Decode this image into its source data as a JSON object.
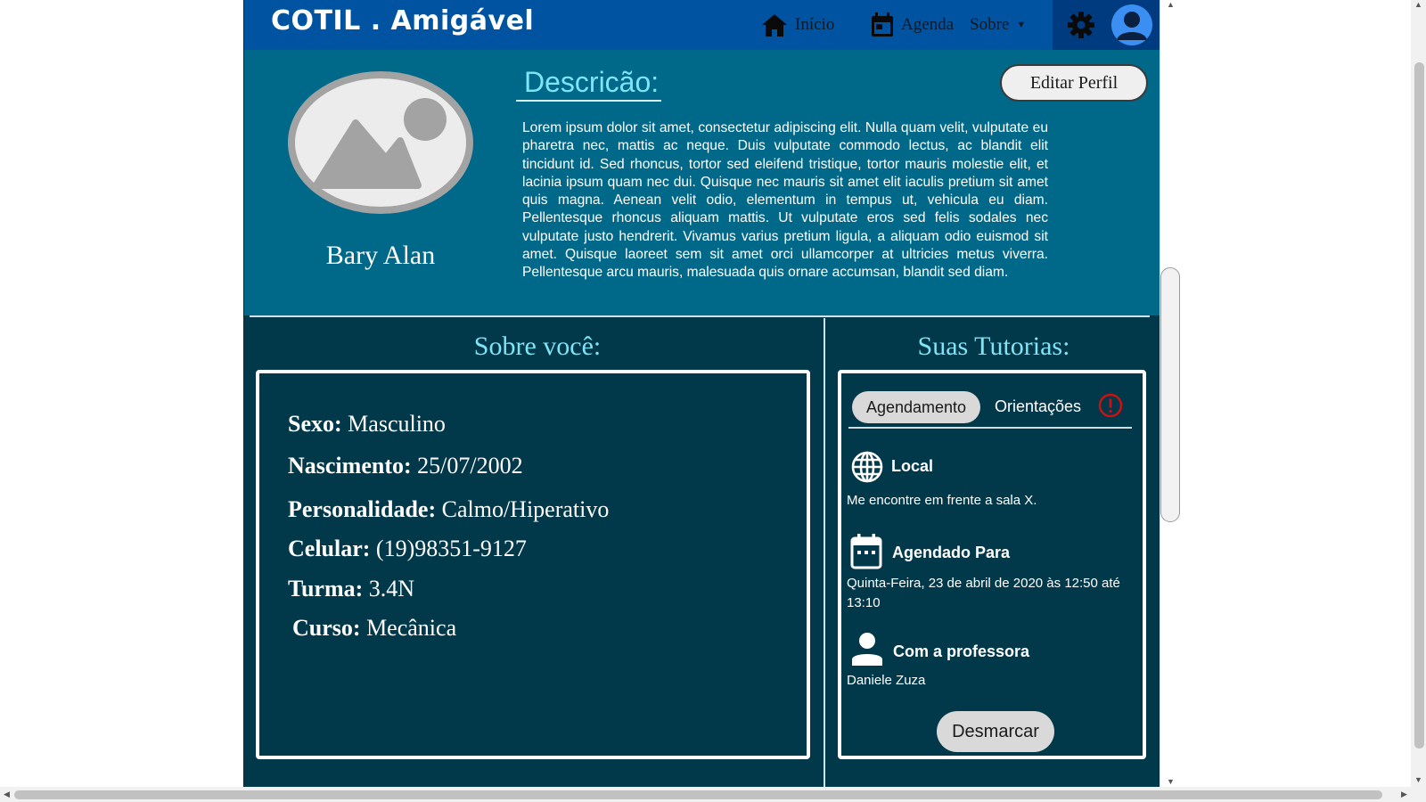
{
  "header": {
    "brand": "COTIL . Amigável",
    "nav": {
      "inicio": "Início",
      "agenda": "Agenda",
      "sobre": "Sobre"
    }
  },
  "profile": {
    "name": "Bary Alan",
    "description_title": "Descricão:",
    "description": "Lorem ipsum dolor sit amet, consectetur adipiscing elit. Nulla quam velit, vulputate eu pharetra nec, mattis ac neque. Duis vulputate commodo lectus, ac blandit elit tincidunt id. Sed rhoncus, tortor sed eleifend tristique, tortor mauris molestie elit, et lacinia ipsum quam nec dui. Quisque nec mauris sit amet elit iaculis pretium sit amet quis magna. Aenean velit odio, elementum in tempus ut, vehicula eu diam. Pellentesque rhoncus aliquam mattis. Ut vulputate eros sed felis sodales nec vulputate justo hendrerit. Vivamus varius pretium ligula, a aliquam odio euismod sit amet. Quisque laoreet sem sit amet orci ullamcorper at ultricies metus viverra. Pellentesque arcu mauris, malesuada quis ornare accumsan, blandit sed diam.",
    "edit_button": "Editar Perfil"
  },
  "about": {
    "title": "Sobre você:",
    "fields": {
      "sexo": {
        "label": "Sexo:",
        "value": "Masculino"
      },
      "nascimento": {
        "label": "Nascimento:",
        "value": "25/07/2002"
      },
      "personalidade": {
        "label": "Personalidade:",
        "value": "Calmo/Hiperativo"
      },
      "celular": {
        "label": "Celular:",
        "value": "(19)98351-9127"
      },
      "turma": {
        "label": "Turma:",
        "value": "3.4N"
      },
      "curso": {
        "label": "Curso:",
        "value": "Mecânica"
      }
    }
  },
  "tutorials": {
    "title": "Suas Tutorias:",
    "tabs": {
      "agendamento": "Agendamento",
      "orientacoes": "Orientações"
    },
    "local": {
      "title": "Local",
      "text": "Me encontre em frente a sala X."
    },
    "schedule": {
      "title": "Agendado Para",
      "text": "Quinta-Feira, 23 de abril de 2020 às 12:50 até 13:10"
    },
    "teacher": {
      "title": "Com a professora",
      "text": "Daniele Zuza"
    },
    "cancel_button": "Desmarcar"
  },
  "colors": {
    "header": "#0053a0",
    "profile_bg": "#006888",
    "content_bg": "#02394a",
    "accent_title": "#7fe4f6",
    "alert": "#cc1111"
  },
  "icons": [
    "home-icon",
    "calendar-icon",
    "caret-down-icon",
    "gear-icon",
    "user-avatar-icon",
    "image-placeholder-icon",
    "alert-icon",
    "globe-icon",
    "calendar-icon",
    "person-icon"
  ]
}
